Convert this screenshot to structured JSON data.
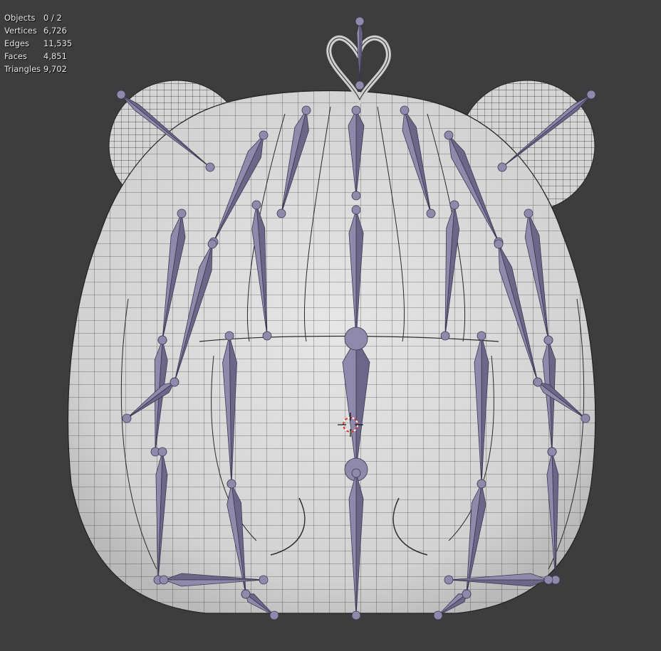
{
  "viewport": {
    "background": "#3d3d3d"
  },
  "stats": [
    {
      "label": "Objects",
      "value": "0 / 2"
    },
    {
      "label": "Vertices",
      "value": "6,726"
    },
    {
      "label": "Edges",
      "value": "11,535"
    },
    {
      "label": "Faces",
      "value": "4,851"
    },
    {
      "label": "Triangles",
      "value": "9,702"
    }
  ],
  "colors": {
    "mesh_fill": "#dcdcdc",
    "mesh_wire": "#2a2a2a",
    "bone_fill": "#8f8aab",
    "bone_dark": "#6c6789",
    "cursor_red": "#d13a3a"
  }
}
